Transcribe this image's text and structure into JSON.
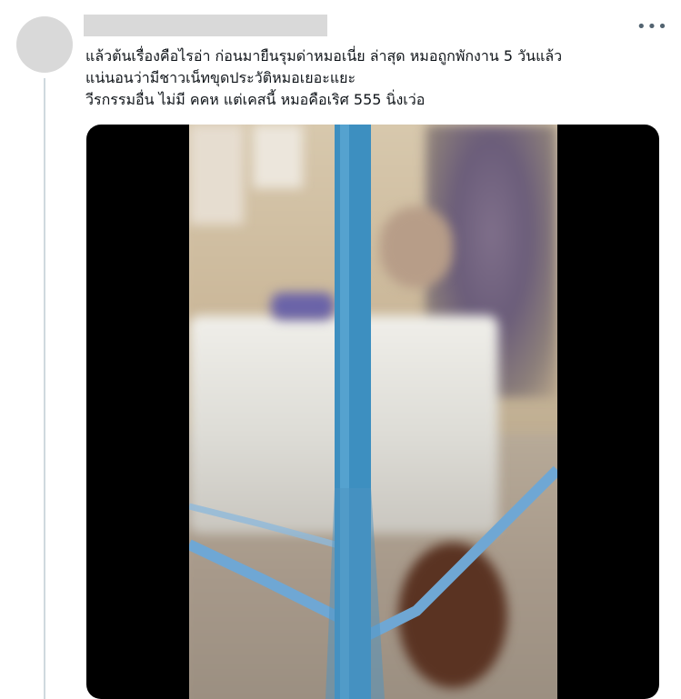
{
  "tweet": {
    "more_icon": "more-horizontal-icon",
    "text_lines": [
      "แล้วต้นเรื่องคือไรอ่า ก่อนมายืนรุมด่าหมอเนี่ย ล่าสุด หมอถูกพักงาน 5 วันแล้ว",
      "แน่นอนว่ามีชาวเน็ทขุดประวัติหมอเยอะแยะ",
      "วีรกรรมอื่น ไม่มี คคห แต่เคสนี้ หมอคือเริศ 555 นิ่งเว่อ"
    ]
  },
  "colors": {
    "thread_line": "#cfd9de",
    "placeholder": "#d9d9d9",
    "media_bg": "#000000",
    "pole": "#3d8fc0"
  }
}
